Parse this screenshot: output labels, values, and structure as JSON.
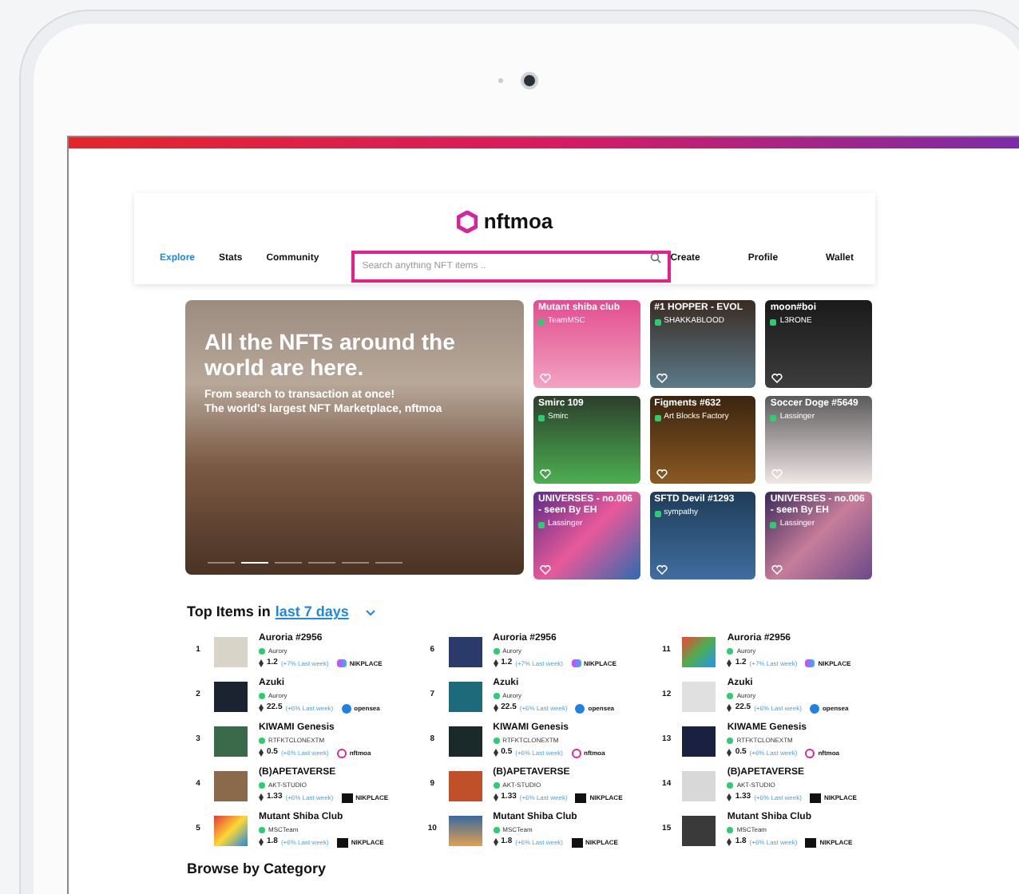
{
  "logo": {
    "text": "nftmoa"
  },
  "nav": [
    {
      "label": "Explore",
      "selected": true
    },
    {
      "label": "Stats",
      "selected": false
    },
    {
      "label": "Community",
      "selected": false
    }
  ],
  "search": {
    "placeholder": "Search anything NFT items .."
  },
  "nav_right": [
    "Create",
    "Profile",
    "Wallet"
  ],
  "hero": {
    "title": "All the NFTs around the world are here.",
    "subtitle": [
      "From search to transaction at once!",
      "The world's largest NFT Marketplace, nftmoa"
    ],
    "slides": [
      {
        "selected": false
      },
      {
        "selected": true
      },
      {
        "selected": false
      },
      {
        "selected": false
      },
      {
        "selected": false
      },
      {
        "selected": false
      }
    ]
  },
  "cards": [
    {
      "title": "Mutant shiba club",
      "creator": "TeamMSC"
    },
    {
      "title": "#1 HOPPER - EVOL",
      "creator": "SHAKKABLOOD"
    },
    {
      "title": "moon#boi",
      "creator": "L3RONE"
    },
    {
      "title": "Smirc 109",
      "creator": "Smirc"
    },
    {
      "title": "Figments #632",
      "creator": "Art Blocks Factory"
    },
    {
      "title": "Soccer Doge #5649",
      "creator": "Lassinger"
    },
    {
      "title": "UNIVERSES - no.006 - seen By EH",
      "creator": "Lassinger"
    },
    {
      "title": "SFTD Devil #1293",
      "creator": "sympathy"
    },
    {
      "title": "UNIVERSES - no.006 - seen By EH",
      "creator": "Lassinger"
    }
  ],
  "top_items": {
    "title": "Top Items in",
    "period": "last 7 days",
    "items": [
      {
        "rank": "1",
        "name": "Auroria #2956",
        "creator": "Aurory",
        "price": "1.2",
        "change": "(+7% Last week)",
        "market": "NIKPLACE",
        "kind": "gradient"
      },
      {
        "rank": "2",
        "name": "Azuki",
        "creator": "Aurory",
        "price": "22.5",
        "change": "(+6% Last week)",
        "market": "opensea",
        "kind": "opensea"
      },
      {
        "rank": "3",
        "name": "KIWAMI Genesis",
        "creator": "RTFKTCLONEXTM",
        "price": "0.5",
        "change": "(+6% Last week)",
        "market": "nftmoa",
        "kind": "nftmoa"
      },
      {
        "rank": "4",
        "name": "(B)APETAVERSE",
        "creator": "AKT-STUDIO",
        "price": "1.33",
        "change": "(+6% Last week)",
        "market": "NIKPLACE",
        "kind": "square"
      },
      {
        "rank": "5",
        "name": "Mutant Shiba Club",
        "creator": "MSCTeam",
        "price": "1.8",
        "change": "(+6% Last week)",
        "market": "NIKPLACE",
        "kind": "square"
      },
      {
        "rank": "6",
        "name": "Auroria #2956",
        "creator": "Aurory",
        "price": "1.2",
        "change": "(+7% Last week)",
        "market": "NIKPLACE",
        "kind": "gradient"
      },
      {
        "rank": "7",
        "name": "Azuki",
        "creator": "Aurory",
        "price": "22.5",
        "change": "(+6% Last week)",
        "market": "opensea",
        "kind": "opensea"
      },
      {
        "rank": "8",
        "name": "KIWAMI Genesis",
        "creator": "RTFKTCLONEXTM",
        "price": "0.5",
        "change": "(+6% Last week)",
        "market": "nftmoa",
        "kind": "nftmoa"
      },
      {
        "rank": "9",
        "name": "(B)APETAVERSE",
        "creator": "AKT-STUDIO",
        "price": "1.33",
        "change": "(+6% Last week)",
        "market": "NIKPLACE",
        "kind": "square"
      },
      {
        "rank": "10",
        "name": "Mutant Shiba Club",
        "creator": "MSCTeam",
        "price": "1.8",
        "change": "(+6% Last week)",
        "market": "NIKPLACE",
        "kind": "square"
      },
      {
        "rank": "11",
        "name": "Auroria #2956",
        "creator": "Aurory",
        "price": "1.2",
        "change": "(+7% Last week)",
        "market": "NIKPLACE",
        "kind": "gradient"
      },
      {
        "rank": "12",
        "name": "Azuki",
        "creator": "Aurory",
        "price": "22.5",
        "change": "(+6% Last week)",
        "market": "opensea",
        "kind": "opensea"
      },
      {
        "rank": "13",
        "name": "KIWAME Genesis",
        "creator": "RTFKTCLONEXTM",
        "price": "0.5",
        "change": "(+6% Last week)",
        "market": "nftmoa",
        "kind": "nftmoa"
      },
      {
        "rank": "14",
        "name": "(B)APETAVERSE",
        "creator": "AKT-STUDIO",
        "price": "1.33",
        "change": "(+6% Last week)",
        "market": "NIKPLACE",
        "kind": "square"
      },
      {
        "rank": "15",
        "name": "Mutant Shiba Club",
        "creator": "MSCTeam",
        "price": "1.8",
        "change": "(+6% Last week)",
        "market": "NIKPLACE",
        "kind": "square"
      }
    ]
  },
  "browse": {
    "title": "Browse by Category"
  }
}
